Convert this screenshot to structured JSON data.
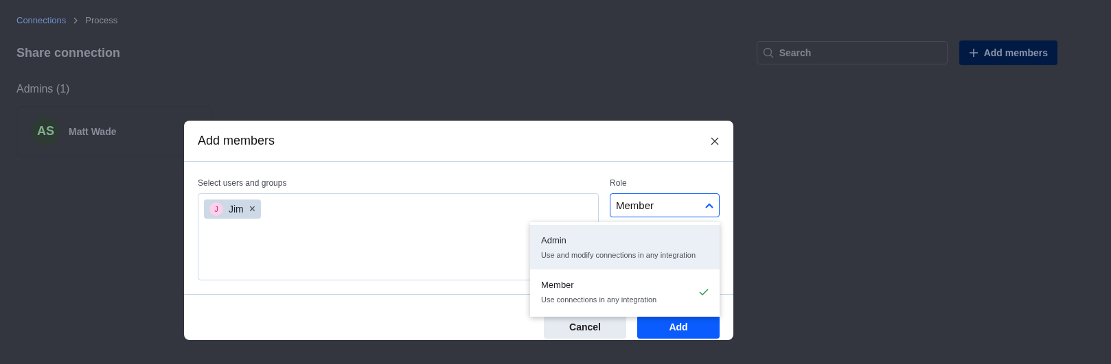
{
  "breadcrumb": [
    {
      "label": "Connections",
      "kind": "link"
    },
    {
      "label": "Process",
      "kind": "current"
    }
  ],
  "page_title": "Share connection",
  "search": {
    "placeholder": "Search"
  },
  "add_members_button": "Add members",
  "admins_heading": "Admins (1)",
  "admins": [
    {
      "initials": "AS",
      "name": "Matt Wade"
    }
  ],
  "dialog": {
    "title": "Add members",
    "users_label": "Select users and groups",
    "selected_users": [
      {
        "initial": "J",
        "name": "Jim",
        "remove": "×"
      }
    ],
    "role_label": "Role",
    "role_value": "Member",
    "role_expanded": true,
    "role_options": [
      {
        "name": "Admin",
        "description": "Use and modify connections in any integration",
        "highlighted": true,
        "selected": false
      },
      {
        "name": "Member",
        "description": "Use connections in any integration",
        "highlighted": false,
        "selected": true
      }
    ],
    "buttons": [
      {
        "label": "Cancel",
        "kind": "secondary"
      },
      {
        "label": "Add",
        "kind": "primary"
      }
    ]
  }
}
